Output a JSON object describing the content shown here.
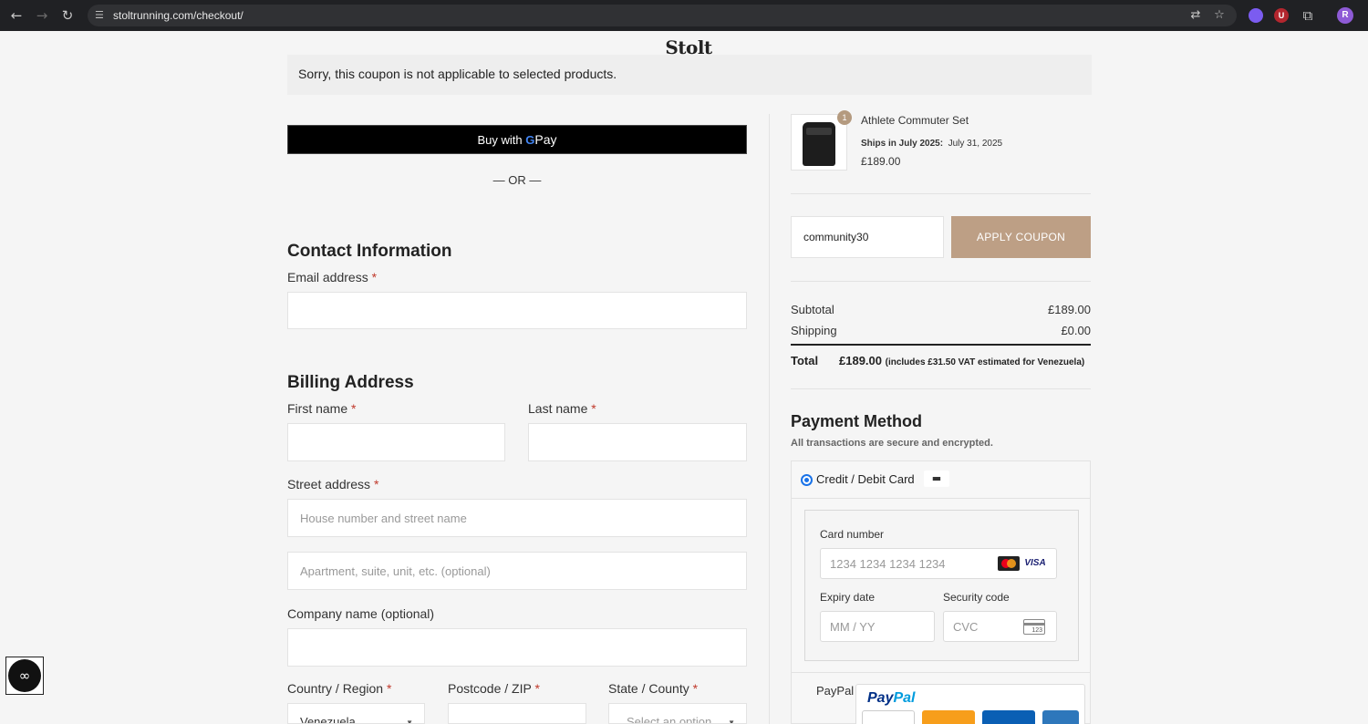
{
  "browser": {
    "url": "stoltrunning.com/checkout/",
    "profile_initial": "R",
    "extensions": [
      {
        "name": "extension-purple",
        "color": "#7b5cf0",
        "glyph": "●"
      },
      {
        "name": "extension-shield",
        "color": "#b3262e",
        "glyph": "U"
      }
    ]
  },
  "brand": {
    "logo_text": "Stolt"
  },
  "notice": {
    "text": "Sorry, this coupon is not applicable to selected products."
  },
  "express": {
    "gpay_prefix": "Buy with",
    "gpay_g": "G",
    "gpay_suffix": "Pay",
    "or_text": "— OR —"
  },
  "contact": {
    "heading": "Contact Information",
    "email_label": "Email address",
    "required_mark": "*"
  },
  "billing": {
    "heading": "Billing Address",
    "first_name_label": "First name",
    "last_name_label": "Last name",
    "street_label": "Street address",
    "street_placeholder": "House number and street name",
    "apt_placeholder": "Apartment, suite, unit, etc. (optional)",
    "company_label": "Company name (optional)",
    "country_label": "Country / Region",
    "country_value": "Venezuela",
    "postcode_label": "Postcode / ZIP",
    "state_label": "State / County",
    "state_placeholder": "Select an option"
  },
  "order": {
    "item": {
      "name": "Athlete Commuter Set",
      "quantity": "1",
      "ship_label": "Ships in July 2025:",
      "ship_date": "July 31, 2025",
      "price": "£189.00"
    },
    "coupon_value": "community30",
    "apply_label": "APPLY COUPON",
    "subtotal_label": "Subtotal",
    "subtotal_value": "£189.00",
    "shipping_label": "Shipping",
    "shipping_value": "£0.00",
    "total_label": "Total",
    "total_value": "£189.00",
    "total_vat_note": "(includes £31.50 VAT estimated for Venezuela)"
  },
  "payment": {
    "heading": "Payment Method",
    "subheading": "All transactions are secure and encrypted.",
    "card_option_label": "Credit / Debit Card",
    "card_number_label": "Card number",
    "card_number_placeholder": "1234 1234 1234 1234",
    "visa_text": "VISA",
    "expiry_label": "Expiry date",
    "expiry_placeholder": "MM / YY",
    "cvc_label": "Security code",
    "cvc_placeholder": "CVC",
    "cvc_icon_text": "123",
    "paypal_option_label": "PayPal",
    "paypal_logo_pay": "Pay",
    "paypal_logo_pal": "Pal",
    "paypal_cards": [
      {
        "name": "visa",
        "color": "#ffffff"
      },
      {
        "name": "mastercard",
        "color": "#f79e1b"
      },
      {
        "name": "maestro",
        "color": "#0a5fb4"
      },
      {
        "name": "amex",
        "color": "#2e77bb"
      }
    ]
  },
  "colors": {
    "accent_button": "#bd9f85",
    "radio_blue": "#1a73e8",
    "required_red": "#c0392b"
  }
}
